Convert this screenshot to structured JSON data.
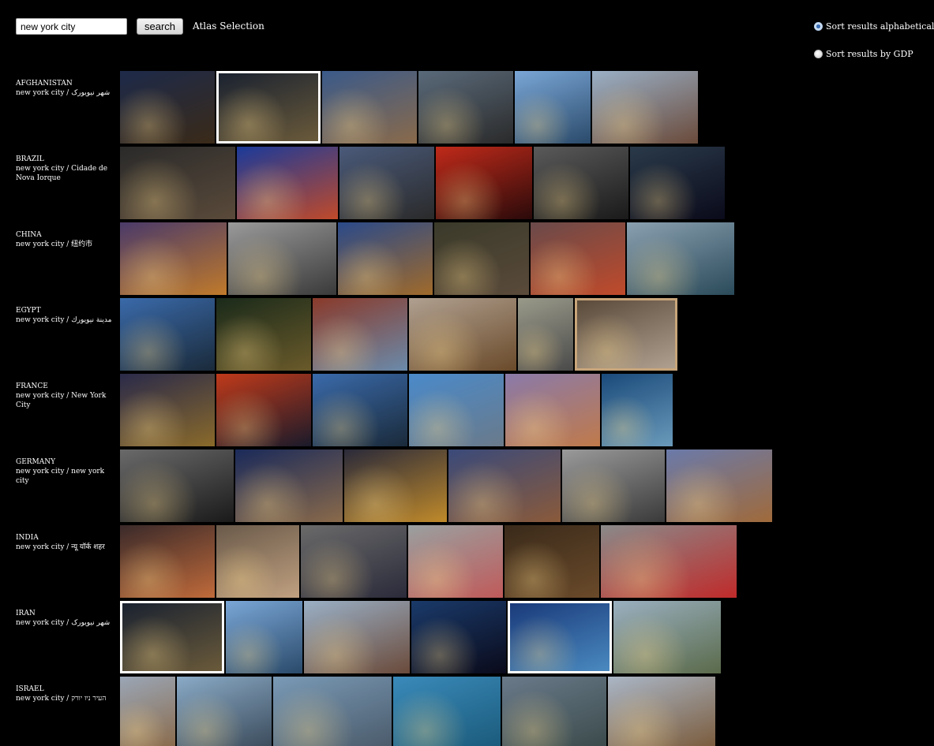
{
  "search": {
    "value": "new york city",
    "button_label": "search"
  },
  "app_title": "Atlas Selection",
  "sort": {
    "alphabetical_label": "Sort results alphabeticall",
    "gdp_label": "Sort results by GDP",
    "selected": "alphabetical"
  },
  "rows": [
    {
      "country": "AFGHANISTAN",
      "term": "new york city / شهر نیویورک",
      "thumbs": [
        {
          "w": 120,
          "c1": "#1d2a4a",
          "c2": "#3a2a18",
          "frame": "none"
        },
        {
          "w": 132,
          "c1": "#1a2230",
          "c2": "#6a5a3a",
          "frame": "white"
        },
        {
          "w": 120,
          "c1": "#3a5a8a",
          "c2": "#8a6a4a",
          "frame": "none"
        },
        {
          "w": 120,
          "c1": "#5a6a7a",
          "c2": "#2a2a2a",
          "frame": "none"
        },
        {
          "w": 96,
          "c1": "#7aa6d6",
          "c2": "#2a4a6a",
          "frame": "none"
        },
        {
          "w": 134,
          "c1": "#9ab0c6",
          "c2": "#6a4a3a",
          "frame": "none"
        }
      ]
    },
    {
      "country": "BRAZIL",
      "term": "new york city / Cidade de Nova Iorque",
      "thumbs": [
        {
          "w": 146,
          "c1": "#2a2a2a",
          "c2": "#5a4a3a",
          "frame": "none"
        },
        {
          "w": 128,
          "c1": "#1a3a9a",
          "c2": "#c04a2a",
          "frame": "none"
        },
        {
          "w": 120,
          "c1": "#4a5a7a",
          "c2": "#2a2a2a",
          "frame": "none"
        },
        {
          "w": 122,
          "c1": "#c02a1a",
          "c2": "#2a0a0a",
          "frame": "none"
        },
        {
          "w": 120,
          "c1": "#5a5a5a",
          "c2": "#1a1a1a",
          "frame": "none"
        },
        {
          "w": 120,
          "c1": "#2a3a4a",
          "c2": "#0a0a1a",
          "frame": "none"
        }
      ]
    },
    {
      "country": "CHINA",
      "term": "new york city / 纽约市",
      "thumbs": [
        {
          "w": 135,
          "c1": "#4a3a6a",
          "c2": "#c07a2a",
          "frame": "none"
        },
        {
          "w": 137,
          "c1": "#9a9a9a",
          "c2": "#3a3a3a",
          "frame": "none"
        },
        {
          "w": 120,
          "c1": "#2a4a8a",
          "c2": "#a06a2a",
          "frame": "none"
        },
        {
          "w": 120,
          "c1": "#3a3a2a",
          "c2": "#5a4a3a",
          "frame": "none"
        },
        {
          "w": 120,
          "c1": "#6a4a4a",
          "c2": "#c04a2a",
          "frame": "none"
        },
        {
          "w": 136,
          "c1": "#8aa0b0",
          "c2": "#2a4a5a",
          "frame": "none"
        }
      ]
    },
    {
      "country": "EGYPT",
      "term": "new york city / مدينة نيويورك",
      "thumbs": [
        {
          "w": 120,
          "c1": "#3a6aaa",
          "c2": "#1a2a3a",
          "frame": "none"
        },
        {
          "w": 120,
          "c1": "#1a2a1a",
          "c2": "#6a5a2a",
          "frame": "none"
        },
        {
          "w": 120,
          "c1": "#8a3a2a",
          "c2": "#6a8aaa",
          "frame": "none"
        },
        {
          "w": 136,
          "c1": "#b0a090",
          "c2": "#6a4a2a",
          "frame": "none"
        },
        {
          "w": 70,
          "c1": "#9a9a8a",
          "c2": "#4a4a4a",
          "frame": "none"
        },
        {
          "w": 130,
          "c1": "#5a4a3a",
          "c2": "#b0a090",
          "frame": "tan"
        }
      ]
    },
    {
      "country": "FRANCE",
      "term": "new york city / New York City",
      "thumbs": [
        {
          "w": 120,
          "c1": "#2a2a4a",
          "c2": "#8a6a2a",
          "frame": "none"
        },
        {
          "w": 120,
          "c1": "#c03a1a",
          "c2": "#1a1a2a",
          "frame": "none"
        },
        {
          "w": 120,
          "c1": "#3a6aaa",
          "c2": "#1a2a3a",
          "frame": "none"
        },
        {
          "w": 120,
          "c1": "#4a8aca",
          "c2": "#6a7a8a",
          "frame": "none"
        },
        {
          "w": 120,
          "c1": "#8a7aaa",
          "c2": "#c07a4a",
          "frame": "none"
        },
        {
          "w": 90,
          "c1": "#1a4a7a",
          "c2": "#6a9aba",
          "frame": "none"
        }
      ]
    },
    {
      "country": "GERMANY",
      "term": "new york city / new york city",
      "thumbs": [
        {
          "w": 144,
          "c1": "#6a6a6a",
          "c2": "#1a1a1a",
          "frame": "none"
        },
        {
          "w": 136,
          "c1": "#1a2a5a",
          "c2": "#8a6a4a",
          "frame": "none"
        },
        {
          "w": 130,
          "c1": "#2a2a3a",
          "c2": "#c08a2a",
          "frame": "none"
        },
        {
          "w": 142,
          "c1": "#3a4a7a",
          "c2": "#8a5a3a",
          "frame": "none"
        },
        {
          "w": 130,
          "c1": "#9a9a9a",
          "c2": "#3a3a3a",
          "frame": "none"
        },
        {
          "w": 134,
          "c1": "#6a7aaa",
          "c2": "#a06a3a",
          "frame": "none"
        }
      ]
    },
    {
      "country": "INDIA",
      "term": "new york city / न्यू यॉर्क शहर",
      "thumbs": [
        {
          "w": 120,
          "c1": "#3a2a2a",
          "c2": "#c06a3a",
          "frame": "none"
        },
        {
          "w": 105,
          "c1": "#6a5a4a",
          "c2": "#c0a080",
          "frame": "none"
        },
        {
          "w": 134,
          "c1": "#6a6a6a",
          "c2": "#2a2a3a",
          "frame": "none"
        },
        {
          "w": 120,
          "c1": "#9aa0a0",
          "c2": "#c05a5a",
          "frame": "none"
        },
        {
          "w": 120,
          "c1": "#3a2a1a",
          "c2": "#6a4a2a",
          "frame": "none"
        },
        {
          "w": 172,
          "c1": "#8a8a8a",
          "c2": "#c02a2a",
          "frame": "none"
        }
      ]
    },
    {
      "country": "IRAN",
      "term": "new york city / شهر نیویورک",
      "thumbs": [
        {
          "w": 132,
          "c1": "#1a2230",
          "c2": "#6a5a3a",
          "frame": "white"
        },
        {
          "w": 97,
          "c1": "#7aa6d6",
          "c2": "#2a4a6a",
          "frame": "none"
        },
        {
          "w": 134,
          "c1": "#9ab0c6",
          "c2": "#6a4a3a",
          "frame": "none"
        },
        {
          "w": 120,
          "c1": "#1a3a6a",
          "c2": "#0a0a1a",
          "frame": "none"
        },
        {
          "w": 132,
          "c1": "#1a3a7a",
          "c2": "#4a8ac0",
          "frame": "white"
        },
        {
          "w": 136,
          "c1": "#9ab0c0",
          "c2": "#5a6a4a",
          "frame": "none"
        }
      ]
    },
    {
      "country": "ISRAEL",
      "term": "new york city / העיר ניו יורק",
      "thumbs": [
        {
          "w": 70,
          "c1": "#9aa6b6",
          "c2": "#8a6a4a",
          "frame": "none"
        },
        {
          "w": 120,
          "c1": "#8aaac6",
          "c2": "#3a4a5a",
          "frame": "none"
        },
        {
          "w": 150,
          "c1": "#7a9ab6",
          "c2": "#4a5a6a",
          "frame": "none"
        },
        {
          "w": 136,
          "c1": "#3a8aba",
          "c2": "#1a5a7a",
          "frame": "none"
        },
        {
          "w": 132,
          "c1": "#6a7a8a",
          "c2": "#3a4a4a",
          "frame": "none"
        },
        {
          "w": 136,
          "c1": "#aab6c6",
          "c2": "#7a5a3a",
          "frame": "none"
        }
      ]
    }
  ]
}
